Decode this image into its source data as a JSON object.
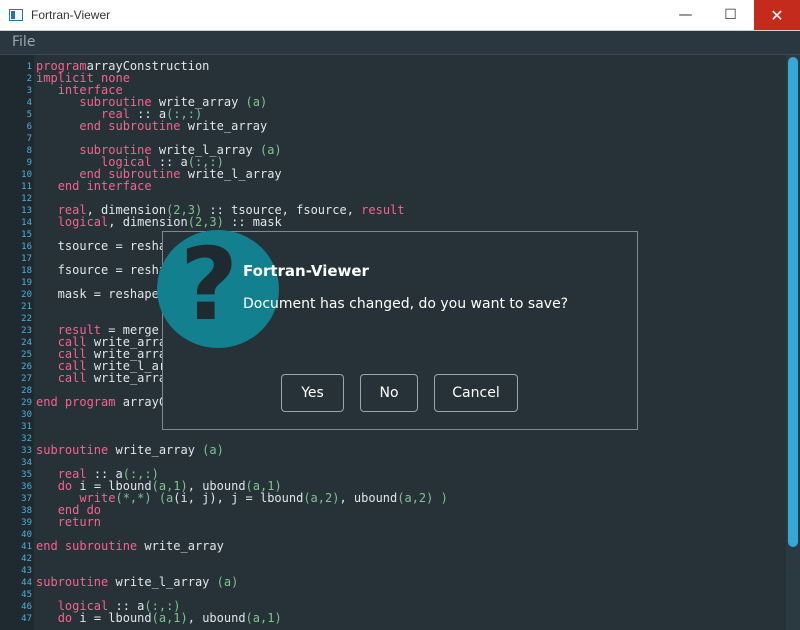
{
  "window": {
    "title": "Fortran-Viewer",
    "minimize_glyph": "—",
    "maximize_glyph": "☐",
    "close_glyph": "✕"
  },
  "menu": {
    "file": "File"
  },
  "editor": {
    "lines": [
      {
        "n": "1",
        "t": [
          [
            "k",
            "program"
          ],
          [
            "",
            "arrayConstruction"
          ]
        ]
      },
      {
        "n": "2",
        "t": [
          [
            "k",
            "implicit none"
          ]
        ]
      },
      {
        "n": "3",
        "t": [
          [
            "",
            "   "
          ],
          [
            "k",
            "interface"
          ]
        ]
      },
      {
        "n": "4",
        "t": [
          [
            "",
            "      "
          ],
          [
            "k",
            "subroutine"
          ],
          [
            "",
            " write_array "
          ],
          [
            "p",
            "(a)"
          ]
        ]
      },
      {
        "n": "5",
        "t": [
          [
            "",
            "         "
          ],
          [
            "k",
            "real"
          ],
          [
            "",
            " :: a"
          ],
          [
            "p",
            "(:,:)"
          ]
        ]
      },
      {
        "n": "6",
        "t": [
          [
            "",
            "      "
          ],
          [
            "k",
            "end subroutine"
          ],
          [
            "",
            " write_array"
          ]
        ]
      },
      {
        "n": "7",
        "t": [
          [
            "",
            ""
          ]
        ]
      },
      {
        "n": "8",
        "t": [
          [
            "",
            "      "
          ],
          [
            "k",
            "subroutine"
          ],
          [
            "",
            " write_l_array "
          ],
          [
            "p",
            "(a)"
          ]
        ]
      },
      {
        "n": "9",
        "t": [
          [
            "",
            "         "
          ],
          [
            "k",
            "logical"
          ],
          [
            "",
            " :: a"
          ],
          [
            "p",
            "(:,:)"
          ]
        ]
      },
      {
        "n": "10",
        "t": [
          [
            "",
            "      "
          ],
          [
            "k",
            "end subroutine"
          ],
          [
            "",
            " write_l_array"
          ]
        ]
      },
      {
        "n": "11",
        "t": [
          [
            "",
            "   "
          ],
          [
            "k",
            "end interface"
          ]
        ]
      },
      {
        "n": "12",
        "t": [
          [
            "",
            ""
          ]
        ]
      },
      {
        "n": "13",
        "t": [
          [
            "",
            "   "
          ],
          [
            "k",
            "real"
          ],
          [
            "",
            ", dimension"
          ],
          [
            "p",
            "(2,3)"
          ],
          [
            "",
            " :: tsource, fsource, "
          ],
          [
            "k",
            "result"
          ]
        ]
      },
      {
        "n": "14",
        "t": [
          [
            "",
            "   "
          ],
          [
            "k",
            "logical"
          ],
          [
            "",
            ", dimension"
          ],
          [
            "p",
            "(2,3)"
          ],
          [
            "",
            " :: mask"
          ]
        ]
      },
      {
        "n": "15",
        "t": [
          [
            "",
            ""
          ]
        ]
      },
      {
        "n": "16",
        "t": [
          [
            "",
            "   tsource = resha"
          ]
        ]
      },
      {
        "n": "17",
        "t": [
          [
            "",
            ""
          ]
        ]
      },
      {
        "n": "18",
        "t": [
          [
            "",
            "   fsource = resha"
          ]
        ]
      },
      {
        "n": "19",
        "t": [
          [
            "",
            ""
          ]
        ]
      },
      {
        "n": "20",
        "t": [
          [
            "",
            "   mask = reshape"
          ]
        ]
      },
      {
        "n": "21",
        "t": [
          [
            "",
            ""
          ]
        ]
      },
      {
        "n": "22",
        "t": [
          [
            "",
            ""
          ]
        ]
      },
      {
        "n": "23",
        "t": [
          [
            "",
            "   "
          ],
          [
            "k",
            "result"
          ],
          [
            "",
            " = merge"
          ]
        ]
      },
      {
        "n": "24",
        "t": [
          [
            "",
            "   "
          ],
          [
            "k",
            "call"
          ],
          [
            "",
            " write_arra"
          ]
        ]
      },
      {
        "n": "25",
        "t": [
          [
            "",
            "   "
          ],
          [
            "k",
            "call"
          ],
          [
            "",
            " write_arra"
          ]
        ]
      },
      {
        "n": "26",
        "t": [
          [
            "",
            "   "
          ],
          [
            "k",
            "call"
          ],
          [
            "",
            " write_l_ar"
          ]
        ]
      },
      {
        "n": "27",
        "t": [
          [
            "",
            "   "
          ],
          [
            "k",
            "call"
          ],
          [
            "",
            " write_arra"
          ]
        ]
      },
      {
        "n": "28",
        "t": [
          [
            "",
            ""
          ]
        ]
      },
      {
        "n": "29",
        "t": [
          [
            "k",
            "end program"
          ],
          [
            "",
            " arrayC"
          ]
        ]
      },
      {
        "n": "30",
        "t": [
          [
            "",
            ""
          ]
        ]
      },
      {
        "n": "31",
        "t": [
          [
            "",
            ""
          ]
        ]
      },
      {
        "n": "32",
        "t": [
          [
            "",
            ""
          ]
        ]
      },
      {
        "n": "33",
        "t": [
          [
            "k",
            "subroutine"
          ],
          [
            "",
            " write_array "
          ],
          [
            "p",
            "(a)"
          ]
        ]
      },
      {
        "n": "34",
        "t": [
          [
            "",
            ""
          ]
        ]
      },
      {
        "n": "35",
        "t": [
          [
            "",
            "   "
          ],
          [
            "k",
            "real"
          ],
          [
            "",
            " :: a"
          ],
          [
            "p",
            "(:,:)"
          ]
        ]
      },
      {
        "n": "36",
        "t": [
          [
            "",
            "   "
          ],
          [
            "k",
            "do"
          ],
          [
            "",
            " i = lbound"
          ],
          [
            "p",
            "(a,1)"
          ],
          [
            "",
            ", ubound"
          ],
          [
            "p",
            "(a,1)"
          ]
        ]
      },
      {
        "n": "37",
        "t": [
          [
            "",
            "      "
          ],
          [
            "k",
            "write"
          ],
          [
            "p",
            "(*,*) (a"
          ],
          [
            "",
            "(i, j), j = lbound"
          ],
          [
            "p",
            "(a,2)"
          ],
          [
            "",
            ", ubound"
          ],
          [
            "p",
            "(a,2) )"
          ]
        ]
      },
      {
        "n": "38",
        "t": [
          [
            "",
            "   "
          ],
          [
            "k",
            "end do"
          ]
        ]
      },
      {
        "n": "39",
        "t": [
          [
            "",
            "   "
          ],
          [
            "k",
            "return"
          ]
        ]
      },
      {
        "n": "40",
        "t": [
          [
            "",
            ""
          ]
        ]
      },
      {
        "n": "41",
        "t": [
          [
            "k",
            "end subroutine"
          ],
          [
            "",
            " write_array"
          ]
        ]
      },
      {
        "n": "42",
        "t": [
          [
            "",
            ""
          ]
        ]
      },
      {
        "n": "43",
        "t": [
          [
            "",
            ""
          ]
        ]
      },
      {
        "n": "44",
        "t": [
          [
            "k",
            "subroutine"
          ],
          [
            "",
            " write_l_array "
          ],
          [
            "p",
            "(a)"
          ]
        ]
      },
      {
        "n": "45",
        "t": [
          [
            "",
            ""
          ]
        ]
      },
      {
        "n": "46",
        "t": [
          [
            "",
            "   "
          ],
          [
            "k",
            "logical"
          ],
          [
            "",
            " :: a"
          ],
          [
            "p",
            "(:,:)"
          ]
        ]
      },
      {
        "n": "47",
        "t": [
          [
            "",
            "   "
          ],
          [
            "k",
            "do"
          ],
          [
            "",
            " i = lbound"
          ],
          [
            "p",
            "(a,1)"
          ],
          [
            "",
            ", ubound"
          ],
          [
            "p",
            "(a,1)"
          ]
        ]
      }
    ]
  },
  "dialog": {
    "title": "Fortran-Viewer",
    "message": "Document has changed, do you want to save?",
    "icon": "question-icon",
    "icon_glyph": "?",
    "buttons": {
      "yes": "Yes",
      "no": "No",
      "cancel": "Cancel"
    }
  },
  "colors": {
    "editor_bg": "#263238",
    "keyword": "#f7628c",
    "paren": "#7fc58c",
    "line_number": "#4fb0d8",
    "accent": "#35a8d8",
    "dialog_icon": "#12808e"
  }
}
